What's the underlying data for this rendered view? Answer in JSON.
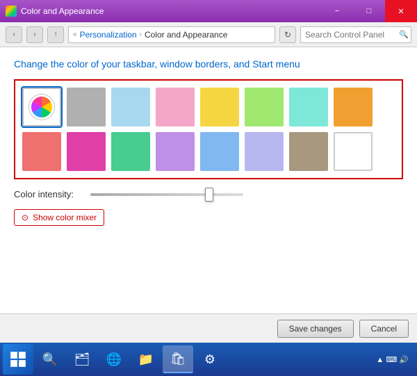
{
  "titleBar": {
    "title": "Color and Appearance",
    "icon": "palette-icon",
    "minimizeLabel": "−",
    "maximizeLabel": "□",
    "closeLabel": "✕"
  },
  "addressBar": {
    "backLabel": "‹",
    "forwardLabel": "›",
    "upLabel": "↑",
    "breadcrumb": {
      "root": "«",
      "path1": "Personalization",
      "separator1": "›",
      "path2": "Color and Appearance"
    },
    "refreshLabel": "↻",
    "searchPlaceholder": "Search Control Panel"
  },
  "main": {
    "heading": "Change the color of your taskbar, window borders, and Start menu",
    "colors": {
      "row1": [
        {
          "id": "sky",
          "color": "#7ec8e3",
          "selected": false
        },
        {
          "id": "pink",
          "color": "#f4a7b9",
          "selected": false
        },
        {
          "id": "yellow",
          "color": "#f5c842",
          "selected": false
        },
        {
          "id": "green",
          "color": "#a8e063",
          "selected": false
        },
        {
          "id": "teal",
          "color": "#7ddbc8",
          "selected": false
        },
        {
          "id": "orange",
          "color": "#f5a623",
          "selected": false
        }
      ],
      "row2": [
        {
          "id": "salmon",
          "color": "#f47a7a",
          "selected": false
        },
        {
          "id": "magenta",
          "color": "#e040a0",
          "selected": false
        },
        {
          "id": "mint",
          "color": "#4cc9a0",
          "selected": false
        },
        {
          "id": "lavender",
          "color": "#c490e4",
          "selected": false
        },
        {
          "id": "cornflower",
          "color": "#7eb8f5",
          "selected": false
        },
        {
          "id": "periwinkle",
          "color": "#b8b8f0",
          "selected": false
        },
        {
          "id": "warmgray",
          "color": "#a89880",
          "selected": false
        },
        {
          "id": "white",
          "color": "#ffffff",
          "selected": false
        }
      ]
    },
    "intensityLabel": "Color intensity:",
    "intensityValue": 75,
    "colorMixerLabel": "Show color mixer"
  },
  "footer": {
    "saveLabel": "Save changes",
    "cancelLabel": "Cancel"
  },
  "taskbar": {
    "items": [
      {
        "id": "search",
        "icon": "🔍"
      },
      {
        "id": "explorer",
        "icon": "📁"
      },
      {
        "id": "ie",
        "icon": "🌐"
      },
      {
        "id": "files",
        "icon": "📂"
      },
      {
        "id": "store",
        "icon": "🛒"
      },
      {
        "id": "settings",
        "icon": "⚙"
      }
    ]
  }
}
